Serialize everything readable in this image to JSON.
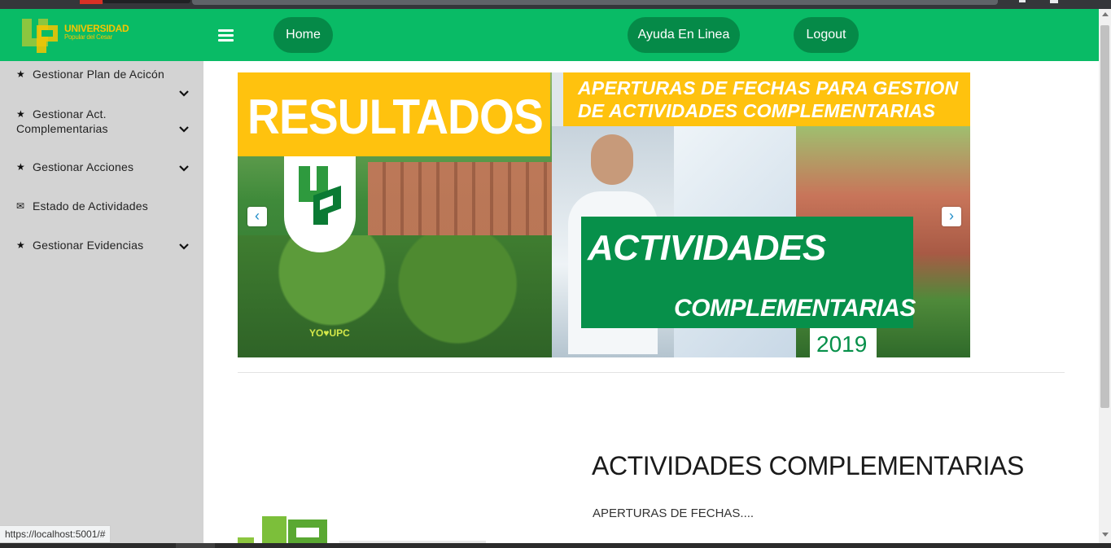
{
  "brand": {
    "name": "UNIVERSIDAD",
    "subtitle": "Popular del Cesar",
    "colors": {
      "primary": "#09bb66",
      "pill": "#058a48",
      "accent": "#ffc20e",
      "dark_green": "#07904a",
      "sidebar": "#d3d3d3"
    }
  },
  "navbar": {
    "menu_icon": "hamburger-icon",
    "home_label": "Home",
    "ayuda_label": "Ayuda En Linea",
    "logout_label": "Logout"
  },
  "sidebar": {
    "items": [
      {
        "label": "Gestionar Plan de Acicón",
        "icon": "star-icon",
        "expandable": true
      },
      {
        "label": "Gestionar Act. Complementarias",
        "icon": "star-icon",
        "expandable": true
      },
      {
        "label": "Gestionar Acciones",
        "icon": "star-icon",
        "expandable": true
      },
      {
        "label": "Estado de Actividades",
        "icon": "envelope-icon",
        "expandable": false
      },
      {
        "label": "Gestionar Evidencias",
        "icon": "star-icon",
        "expandable": true
      }
    ]
  },
  "carousel": {
    "prev_label": "‹",
    "next_label": "›",
    "left_banner": {
      "heading": "RESULTADOS",
      "tag": "YO♥UPC"
    },
    "right_banner": {
      "heading": "APERTURAS DE FECHAS PARA GESTION DE ACTIVIDADES COMPLEMENTARIAS",
      "title_1": "ACTIVIDADES",
      "title_2": "COMPLEMENTARIAS",
      "year": "2019"
    }
  },
  "section": {
    "title": "ACTIVIDADES COMPLEMENTARIAS",
    "subtitle": "APERTURAS DE FECHAS...."
  },
  "status_bar": {
    "url": "https://localhost:5001/#"
  }
}
